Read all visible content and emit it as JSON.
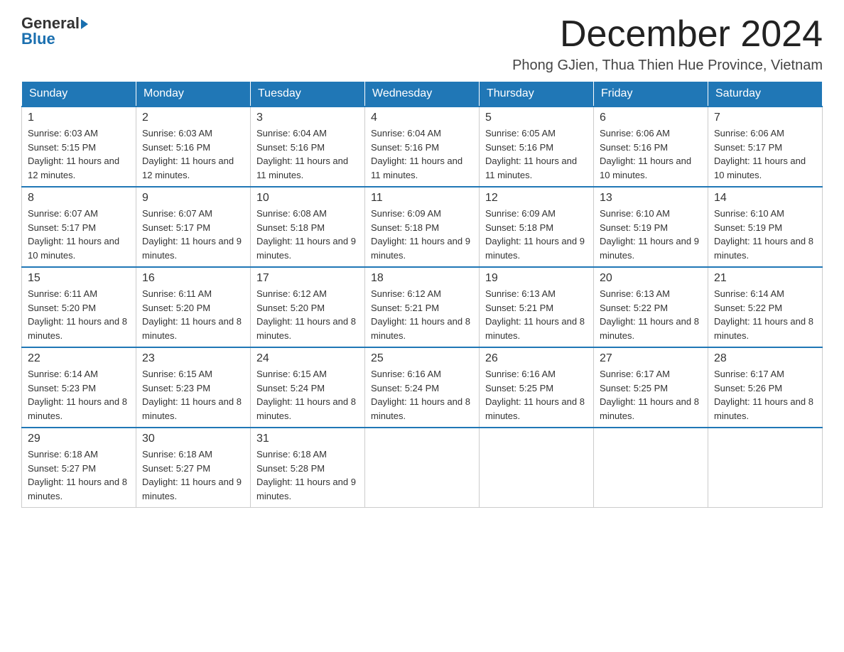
{
  "logo": {
    "general": "General",
    "blue": "Blue"
  },
  "title": "December 2024",
  "location": "Phong GJien, Thua Thien Hue Province, Vietnam",
  "days_of_week": [
    "Sunday",
    "Monday",
    "Tuesday",
    "Wednesday",
    "Thursday",
    "Friday",
    "Saturday"
  ],
  "weeks": [
    [
      {
        "day": "1",
        "sunrise": "6:03 AM",
        "sunset": "5:15 PM",
        "daylight": "11 hours and 12 minutes."
      },
      {
        "day": "2",
        "sunrise": "6:03 AM",
        "sunset": "5:16 PM",
        "daylight": "11 hours and 12 minutes."
      },
      {
        "day": "3",
        "sunrise": "6:04 AM",
        "sunset": "5:16 PM",
        "daylight": "11 hours and 11 minutes."
      },
      {
        "day": "4",
        "sunrise": "6:04 AM",
        "sunset": "5:16 PM",
        "daylight": "11 hours and 11 minutes."
      },
      {
        "day": "5",
        "sunrise": "6:05 AM",
        "sunset": "5:16 PM",
        "daylight": "11 hours and 11 minutes."
      },
      {
        "day": "6",
        "sunrise": "6:06 AM",
        "sunset": "5:16 PM",
        "daylight": "11 hours and 10 minutes."
      },
      {
        "day": "7",
        "sunrise": "6:06 AM",
        "sunset": "5:17 PM",
        "daylight": "11 hours and 10 minutes."
      }
    ],
    [
      {
        "day": "8",
        "sunrise": "6:07 AM",
        "sunset": "5:17 PM",
        "daylight": "11 hours and 10 minutes."
      },
      {
        "day": "9",
        "sunrise": "6:07 AM",
        "sunset": "5:17 PM",
        "daylight": "11 hours and 9 minutes."
      },
      {
        "day": "10",
        "sunrise": "6:08 AM",
        "sunset": "5:18 PM",
        "daylight": "11 hours and 9 minutes."
      },
      {
        "day": "11",
        "sunrise": "6:09 AM",
        "sunset": "5:18 PM",
        "daylight": "11 hours and 9 minutes."
      },
      {
        "day": "12",
        "sunrise": "6:09 AM",
        "sunset": "5:18 PM",
        "daylight": "11 hours and 9 minutes."
      },
      {
        "day": "13",
        "sunrise": "6:10 AM",
        "sunset": "5:19 PM",
        "daylight": "11 hours and 9 minutes."
      },
      {
        "day": "14",
        "sunrise": "6:10 AM",
        "sunset": "5:19 PM",
        "daylight": "11 hours and 8 minutes."
      }
    ],
    [
      {
        "day": "15",
        "sunrise": "6:11 AM",
        "sunset": "5:20 PM",
        "daylight": "11 hours and 8 minutes."
      },
      {
        "day": "16",
        "sunrise": "6:11 AM",
        "sunset": "5:20 PM",
        "daylight": "11 hours and 8 minutes."
      },
      {
        "day": "17",
        "sunrise": "6:12 AM",
        "sunset": "5:20 PM",
        "daylight": "11 hours and 8 minutes."
      },
      {
        "day": "18",
        "sunrise": "6:12 AM",
        "sunset": "5:21 PM",
        "daylight": "11 hours and 8 minutes."
      },
      {
        "day": "19",
        "sunrise": "6:13 AM",
        "sunset": "5:21 PM",
        "daylight": "11 hours and 8 minutes."
      },
      {
        "day": "20",
        "sunrise": "6:13 AM",
        "sunset": "5:22 PM",
        "daylight": "11 hours and 8 minutes."
      },
      {
        "day": "21",
        "sunrise": "6:14 AM",
        "sunset": "5:22 PM",
        "daylight": "11 hours and 8 minutes."
      }
    ],
    [
      {
        "day": "22",
        "sunrise": "6:14 AM",
        "sunset": "5:23 PM",
        "daylight": "11 hours and 8 minutes."
      },
      {
        "day": "23",
        "sunrise": "6:15 AM",
        "sunset": "5:23 PM",
        "daylight": "11 hours and 8 minutes."
      },
      {
        "day": "24",
        "sunrise": "6:15 AM",
        "sunset": "5:24 PM",
        "daylight": "11 hours and 8 minutes."
      },
      {
        "day": "25",
        "sunrise": "6:16 AM",
        "sunset": "5:24 PM",
        "daylight": "11 hours and 8 minutes."
      },
      {
        "day": "26",
        "sunrise": "6:16 AM",
        "sunset": "5:25 PM",
        "daylight": "11 hours and 8 minutes."
      },
      {
        "day": "27",
        "sunrise": "6:17 AM",
        "sunset": "5:25 PM",
        "daylight": "11 hours and 8 minutes."
      },
      {
        "day": "28",
        "sunrise": "6:17 AM",
        "sunset": "5:26 PM",
        "daylight": "11 hours and 8 minutes."
      }
    ],
    [
      {
        "day": "29",
        "sunrise": "6:18 AM",
        "sunset": "5:27 PM",
        "daylight": "11 hours and 8 minutes."
      },
      {
        "day": "30",
        "sunrise": "6:18 AM",
        "sunset": "5:27 PM",
        "daylight": "11 hours and 9 minutes."
      },
      {
        "day": "31",
        "sunrise": "6:18 AM",
        "sunset": "5:28 PM",
        "daylight": "11 hours and 9 minutes."
      },
      null,
      null,
      null,
      null
    ]
  ]
}
